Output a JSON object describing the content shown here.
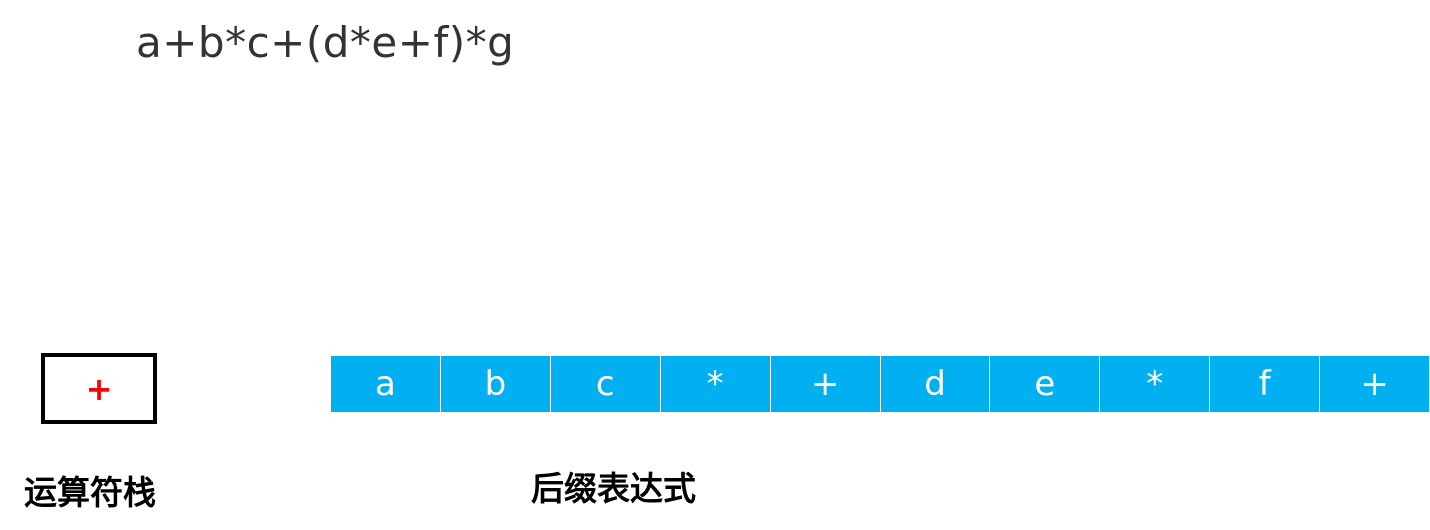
{
  "expression": "a+b*c+(d*e+f)*g",
  "operator_stack": {
    "label": "运算符栈",
    "items": [
      "+"
    ],
    "item_color": "#ff0000"
  },
  "postfix": {
    "label": "后缀表达式",
    "cells": [
      "a",
      "b",
      "c",
      "*",
      "+",
      "d",
      "e",
      "*",
      "f",
      "+"
    ],
    "cell_color": "#00b0f0"
  }
}
